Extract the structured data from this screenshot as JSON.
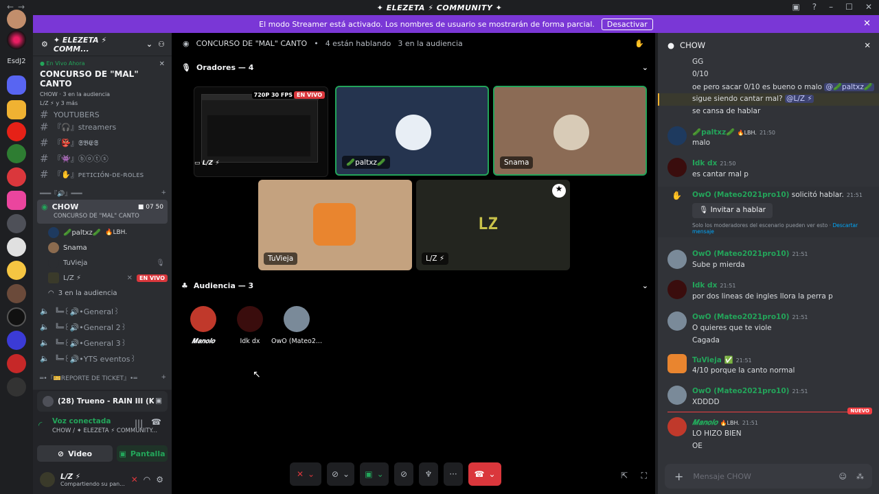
{
  "window": {
    "title": "✦ ELEZETA ⚡ COMMUNITY ✦"
  },
  "banner": {
    "text": "El modo Streamer está activado. Los nombres de usuario se mostrarán de forma parcial.",
    "button": "Desactivar"
  },
  "guilds": {
    "label": "EsdJ2"
  },
  "server": {
    "name": "✦ ELEZETA ⚡ COMM...",
    "live_now": "En Vivo Ahora",
    "stage_title": "CONCURSO DE \"MAL\" CANTO",
    "audience_line": "CHOW · 3 en la audiencia",
    "speakers_line": "L/Z ⚡ y 3 más"
  },
  "channels": [
    {
      "name": "YOUTUBERS"
    },
    {
      "name": "『🎧』streamers"
    },
    {
      "name": "『👺』𝕾𝕭𝕰𝕾"
    },
    {
      "name": "『👾』ⓑⓞⓣⓢ"
    },
    {
      "name": "『✋』ᴘᴇᴛɪᴄɪóɴ-ᴅᴇ-ʀᴏʟᴇs"
    }
  ],
  "divider_category": "═══『🔊』═══",
  "voice_channel": {
    "name": "CHOW",
    "sub": "CONCURSO DE \"MAL\" CANTO",
    "video_count": "07",
    "user_count": "50",
    "users": [
      {
        "name": "🥒paltxz🥒",
        "tag": "🔥LBH."
      },
      {
        "name": "Snama",
        "tag": ""
      },
      {
        "name": "TuVieja",
        "tag": ""
      },
      {
        "name": "L/Z ⚡",
        "tag": "EN VIVO"
      }
    ],
    "audience": "3 en la audiencia"
  },
  "other_voice": [
    {
      "name": "╚═꒰🔊•General꒱"
    },
    {
      "name": "╚═꒰🔊•General 2꒱"
    },
    {
      "name": "╚═꒰🔊•General 3꒱"
    },
    {
      "name": "╚═꒰🔊•YTS eventos꒱"
    }
  ],
  "ticket_category": "═•『🎫REPORTE DE TICKET』•═",
  "now_playing": "(28) Trueno - RAIN III (KARAOKE - I...",
  "voice_status": {
    "title": "Voz conectada",
    "sub": "CHOW / ✦ ELEZETA ⚡ COMMUNITY..."
  },
  "buttons": {
    "video": "Video",
    "screen": "Pantalla"
  },
  "user": {
    "name": "L/Z ⚡",
    "status": "Compartiendo su pan..."
  },
  "stage": {
    "header_title": "CONCURSO DE \"MAL\" CANTO",
    "talking": "4 están hablando",
    "audience": "3 en la audiencia",
    "speakers_label": "Oradores — 4",
    "audience_label": "Audiencia — 3",
    "stream_badge": "720P 30 FPS",
    "live_badge": "EN VIVO",
    "stream_name": "L/Z ⚡",
    "tiles": [
      {
        "name": "🥒paltxz🥒"
      },
      {
        "name": "Snama"
      },
      {
        "name": "TuVieja"
      },
      {
        "name": "L/Z ⚡"
      }
    ],
    "tile_logo": "LZ",
    "audience_users": [
      {
        "name": "𝑴𝒂𝒏𝒐𝒍𝒐"
      },
      {
        "name": "Idk dx"
      },
      {
        "name": "OwO (Mateo2..."
      }
    ]
  },
  "chat": {
    "channel": "CHOW",
    "placeholder": "Mensaje CHOW",
    "new_label": "NUEVO",
    "top_lines": [
      "GG",
      "0/10",
      "oe pero sacar 0/10 es bueno o malo",
      "sigue siendo cantar mal?",
      "se cansa de hablar"
    ],
    "mention1": "@🥒paltxz🥒",
    "mention2": "@L/Z ⚡",
    "messages": [
      {
        "author": "🥒paltxz🥒",
        "tag": "🔥LBH.",
        "time": "21:50",
        "lines": [
          "malo"
        ],
        "color": "#23a55a"
      },
      {
        "author": "Idk dx",
        "tag": "",
        "time": "21:50",
        "lines": [
          "es cantar mal p"
        ],
        "color": "#23a55a"
      },
      {
        "author": "OwO (Mateo2021pro10)",
        "tag": "",
        "time": "21:51",
        "lines": [
          "Sube p mierda"
        ],
        "color": "#23a55a"
      },
      {
        "author": "Idk dx",
        "tag": "",
        "time": "21:51",
        "lines": [
          "por dos lineas de ingles llora la perra p"
        ],
        "color": "#23a55a"
      },
      {
        "author": "OwO (Mateo2021pro10)",
        "tag": "",
        "time": "21:51",
        "lines": [
          "O quieres que te viole",
          "Cagada"
        ],
        "color": "#23a55a"
      },
      {
        "author": "TuVieja ✅",
        "tag": "",
        "time": "21:51",
        "lines": [
          "4/10 porque la canto normal"
        ],
        "color": "#23a55a"
      },
      {
        "author": "OwO (Mateo2021pro10)",
        "tag": "",
        "time": "21:51",
        "lines": [
          "XDDDD"
        ],
        "color": "#23a55a"
      },
      {
        "author": "𝑴𝒂𝒏𝒐𝒍𝒐",
        "tag": "🔥LBH.",
        "time": "21:51",
        "lines": [
          "LO HIZO BIEN",
          "OE"
        ],
        "color": "#23a55a"
      }
    ],
    "request": {
      "author": "OwO (Mateo2021pro10)",
      "action": "solicitó hablar.",
      "time": "21:51",
      "button": "Invitar a hablar",
      "note": "Solo los moderadores del escenario pueden ver esto ·",
      "link": "Descartar",
      "link2": "mensaje"
    }
  }
}
